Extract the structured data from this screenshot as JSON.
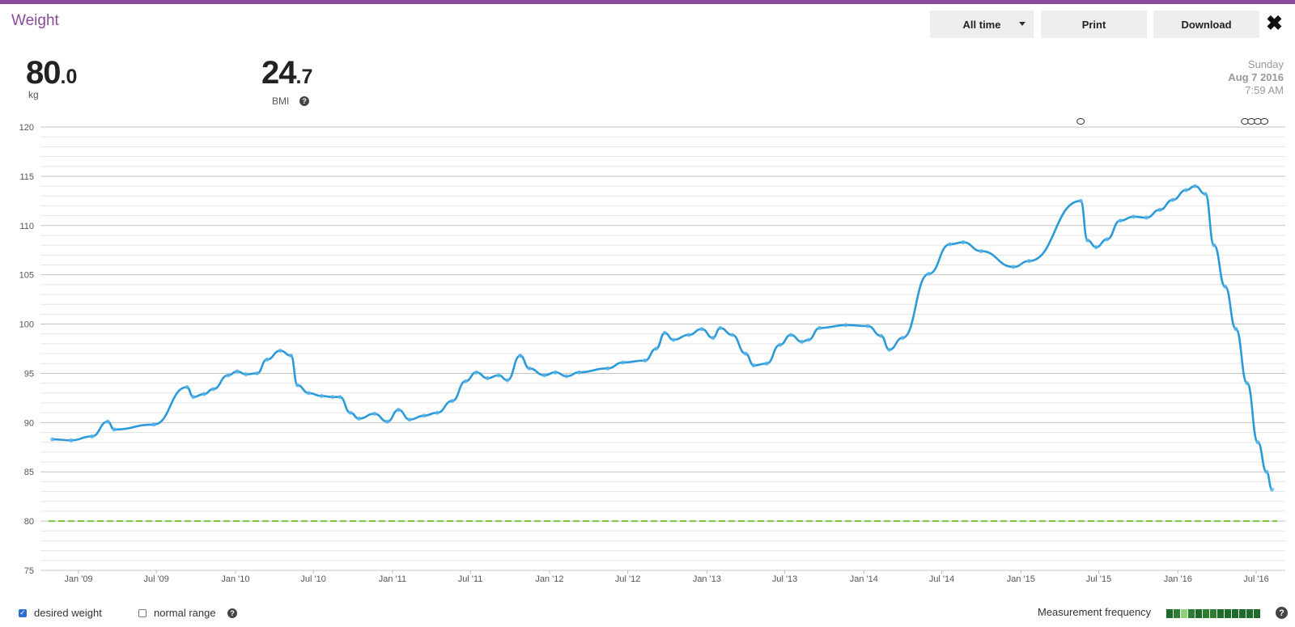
{
  "header": {
    "title": "Weight"
  },
  "toolbar": {
    "range_label": "All time",
    "print_label": "Print",
    "download_label": "Download"
  },
  "stats": {
    "weight": {
      "int": "80",
      "dec": ".0",
      "unit": "kg"
    },
    "bmi": {
      "int": "24",
      "dec": ".7",
      "label": "BMI"
    }
  },
  "measurement_date": {
    "weekday": "Sunday",
    "date": "Aug 7 2016",
    "time": "7:59 AM"
  },
  "legend": {
    "desired_weight": "desired weight",
    "normal_range": "normal range",
    "desired_checked": true,
    "normal_checked": false
  },
  "frequency": {
    "label": "Measurement frequency",
    "colors": [
      "#1e6b2a",
      "#2e7d32",
      "#8fd07a",
      "#2e7d32",
      "#1e6b2a",
      "#2e7d32",
      "#2e7d32",
      "#1e6b2a",
      "#1e6b2a",
      "#1e6b2a",
      "#1e6b2a",
      "#1e6b2a",
      "#1e6b2a"
    ]
  },
  "icons": {
    "close": "close-icon",
    "help": "help-icon",
    "dropdown": "chevron-down-icon",
    "comment": "comment-icon"
  },
  "colors": {
    "accent": "#8a4a9a",
    "trend": "#2b9ad9",
    "goal": "#7cc142"
  },
  "chart_data": {
    "type": "line",
    "ylim": [
      75,
      120
    ],
    "yticks": [
      "75",
      "80",
      "85",
      "90",
      "95",
      "100",
      "105",
      "110",
      "115",
      "120"
    ],
    "xticks": [
      {
        "date": "2009-01",
        "label": "Jan '09"
      },
      {
        "date": "2009-07",
        "label": "Jul '09"
      },
      {
        "date": "2010-01",
        "label": "Jan '10"
      },
      {
        "date": "2010-07",
        "label": "Jul '10"
      },
      {
        "date": "2011-01",
        "label": "Jan '11"
      },
      {
        "date": "2011-07",
        "label": "Jul '11"
      },
      {
        "date": "2012-01",
        "label": "Jan '12"
      },
      {
        "date": "2012-07",
        "label": "Jul '12"
      },
      {
        "date": "2013-01",
        "label": "Jan '13"
      },
      {
        "date": "2013-07",
        "label": "Jul '13"
      },
      {
        "date": "2014-01",
        "label": "Jan '14"
      },
      {
        "date": "2014-07",
        "label": "Jul '14"
      },
      {
        "date": "2015-01",
        "label": "Jan '15"
      },
      {
        "date": "2015-07",
        "label": "Jul '15"
      },
      {
        "date": "2016-01",
        "label": "Jan '16"
      },
      {
        "date": "2016-07",
        "label": "Jul '16"
      }
    ],
    "goal_weight": 80,
    "comment_markers": [
      "2015-05-20",
      "2016-06-05",
      "2016-06-20",
      "2016-07-05",
      "2016-07-20"
    ],
    "trend": [
      [
        "2008-11-01",
        88.3
      ],
      [
        "2008-12-15",
        88.2
      ],
      [
        "2009-02-01",
        88.6
      ],
      [
        "2009-03-10",
        90.1
      ],
      [
        "2009-03-25",
        89.3
      ],
      [
        "2009-06-25",
        89.8
      ],
      [
        "2009-09-10",
        93.6
      ],
      [
        "2009-09-25",
        92.6
      ],
      [
        "2009-10-20",
        92.9
      ],
      [
        "2009-11-10",
        93.4
      ],
      [
        "2009-12-15",
        94.8
      ],
      [
        "2010-01-05",
        95.2
      ],
      [
        "2010-01-25",
        94.9
      ],
      [
        "2010-02-20",
        95.0
      ],
      [
        "2010-03-15",
        96.4
      ],
      [
        "2010-04-15",
        97.3
      ],
      [
        "2010-05-10",
        96.8
      ],
      [
        "2010-05-25",
        93.8
      ],
      [
        "2010-06-20",
        93.0
      ],
      [
        "2010-07-20",
        92.7
      ],
      [
        "2010-08-15",
        92.6
      ],
      [
        "2010-09-01",
        92.6
      ],
      [
        "2010-09-25",
        91.0
      ],
      [
        "2010-10-15",
        90.4
      ],
      [
        "2010-11-20",
        90.9
      ],
      [
        "2010-12-20",
        90.1
      ],
      [
        "2011-01-15",
        91.3
      ],
      [
        "2011-02-10",
        90.3
      ],
      [
        "2011-03-15",
        90.7
      ],
      [
        "2011-04-15",
        91.0
      ],
      [
        "2011-05-20",
        92.2
      ],
      [
        "2011-06-20",
        94.2
      ],
      [
        "2011-07-15",
        95.1
      ],
      [
        "2011-08-10",
        94.5
      ],
      [
        "2011-09-05",
        94.8
      ],
      [
        "2011-09-25",
        94.3
      ],
      [
        "2011-10-25",
        96.8
      ],
      [
        "2011-11-15",
        95.5
      ],
      [
        "2011-12-20",
        94.8
      ],
      [
        "2012-01-15",
        95.1
      ],
      [
        "2012-02-10",
        94.7
      ],
      [
        "2012-03-10",
        95.1
      ],
      [
        "2012-05-15",
        95.5
      ],
      [
        "2012-06-20",
        96.1
      ],
      [
        "2012-08-10",
        96.3
      ],
      [
        "2012-09-05",
        97.5
      ],
      [
        "2012-09-25",
        99.1
      ],
      [
        "2012-10-15",
        98.4
      ],
      [
        "2012-11-20",
        98.9
      ],
      [
        "2012-12-20",
        99.5
      ],
      [
        "2013-01-15",
        98.6
      ],
      [
        "2013-02-01",
        99.6
      ],
      [
        "2013-03-01",
        98.9
      ],
      [
        "2013-04-01",
        97.0
      ],
      [
        "2013-04-20",
        95.8
      ],
      [
        "2013-05-20",
        96.0
      ],
      [
        "2013-06-20",
        97.9
      ],
      [
        "2013-07-15",
        98.9
      ],
      [
        "2013-08-10",
        98.2
      ],
      [
        "2013-08-25",
        98.4
      ],
      [
        "2013-09-20",
        99.6
      ],
      [
        "2013-11-20",
        99.9
      ],
      [
        "2014-01-10",
        99.8
      ],
      [
        "2014-02-10",
        98.8
      ],
      [
        "2014-03-01",
        97.4
      ],
      [
        "2014-04-01",
        98.6
      ],
      [
        "2014-06-01",
        105.1
      ],
      [
        "2014-07-20",
        108.1
      ],
      [
        "2014-08-20",
        108.3
      ],
      [
        "2014-10-01",
        107.4
      ],
      [
        "2014-12-15",
        105.8
      ],
      [
        "2015-01-20",
        106.4
      ],
      [
        "2015-05-20",
        112.5
      ],
      [
        "2015-06-05",
        108.5
      ],
      [
        "2015-06-25",
        107.8
      ],
      [
        "2015-07-20",
        108.6
      ],
      [
        "2015-08-20",
        110.5
      ],
      [
        "2015-09-20",
        110.9
      ],
      [
        "2015-10-20",
        110.8
      ],
      [
        "2015-11-20",
        111.6
      ],
      [
        "2015-12-20",
        112.6
      ],
      [
        "2016-01-20",
        113.6
      ],
      [
        "2016-02-10",
        114.0
      ],
      [
        "2016-03-05",
        113.2
      ],
      [
        "2016-03-25",
        108.0
      ],
      [
        "2016-04-20",
        103.8
      ],
      [
        "2016-05-15",
        99.5
      ],
      [
        "2016-06-10",
        94.0
      ],
      [
        "2016-07-05",
        88.0
      ],
      [
        "2016-07-25",
        85.0
      ],
      [
        "2016-08-07",
        83.2
      ]
    ]
  }
}
